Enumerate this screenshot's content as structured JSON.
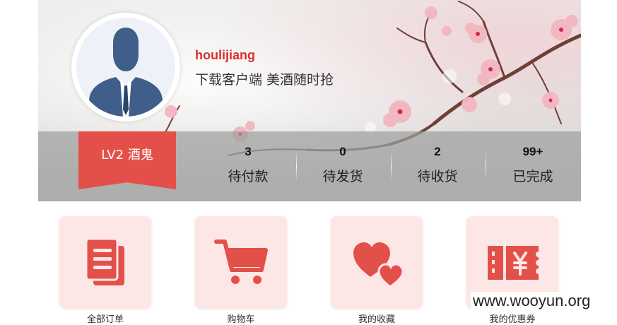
{
  "profile": {
    "username": "houlijiang",
    "slogan": "下载客户端 美酒随时抢",
    "level": "LV2 酒鬼"
  },
  "order_stats": [
    {
      "count": "3",
      "label": "待付款"
    },
    {
      "count": "0",
      "label": "待发货"
    },
    {
      "count": "2",
      "label": "待收货"
    },
    {
      "count": "99+",
      "label": "已完成"
    }
  ],
  "shortcuts": [
    {
      "label": "全部订单",
      "icon": "orders-document-icon"
    },
    {
      "label": "购物车",
      "icon": "shopping-cart-icon"
    },
    {
      "label": "我的收藏",
      "icon": "hearts-icon"
    },
    {
      "label": "我的优惠券",
      "icon": "coupon-yen-icon"
    }
  ],
  "watermark": "www.wooyun.org",
  "colors": {
    "accent": "#e3504a",
    "username": "#d9302b",
    "tile_bg": "#fde7e6"
  }
}
